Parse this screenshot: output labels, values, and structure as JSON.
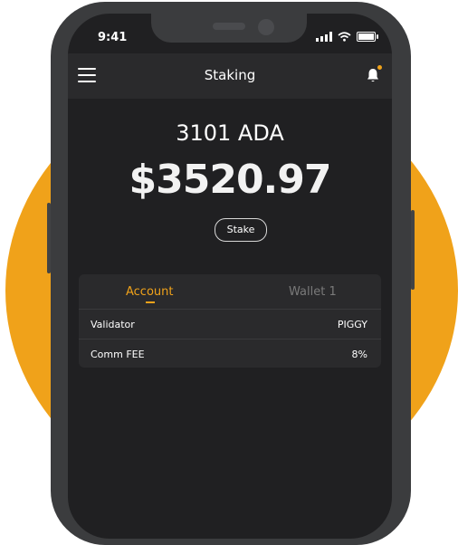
{
  "status_bar": {
    "time": "9:41"
  },
  "header": {
    "title": "Staking"
  },
  "balance": {
    "ada": "3101 ADA",
    "usd": "$3520.97"
  },
  "stake_button": {
    "label": "Stake"
  },
  "tabs": [
    {
      "label": "Account",
      "active": true
    },
    {
      "label": "Wallet 1",
      "active": false
    }
  ],
  "details": [
    {
      "label": "Validator",
      "value": "PIGGY"
    },
    {
      "label": "Comm FEE",
      "value": "8%"
    }
  ],
  "colors": {
    "accent": "#f0a21a",
    "screen_bg": "#202022",
    "panel_bg": "#2a2a2c",
    "phone_body": "#3b3c3e"
  }
}
